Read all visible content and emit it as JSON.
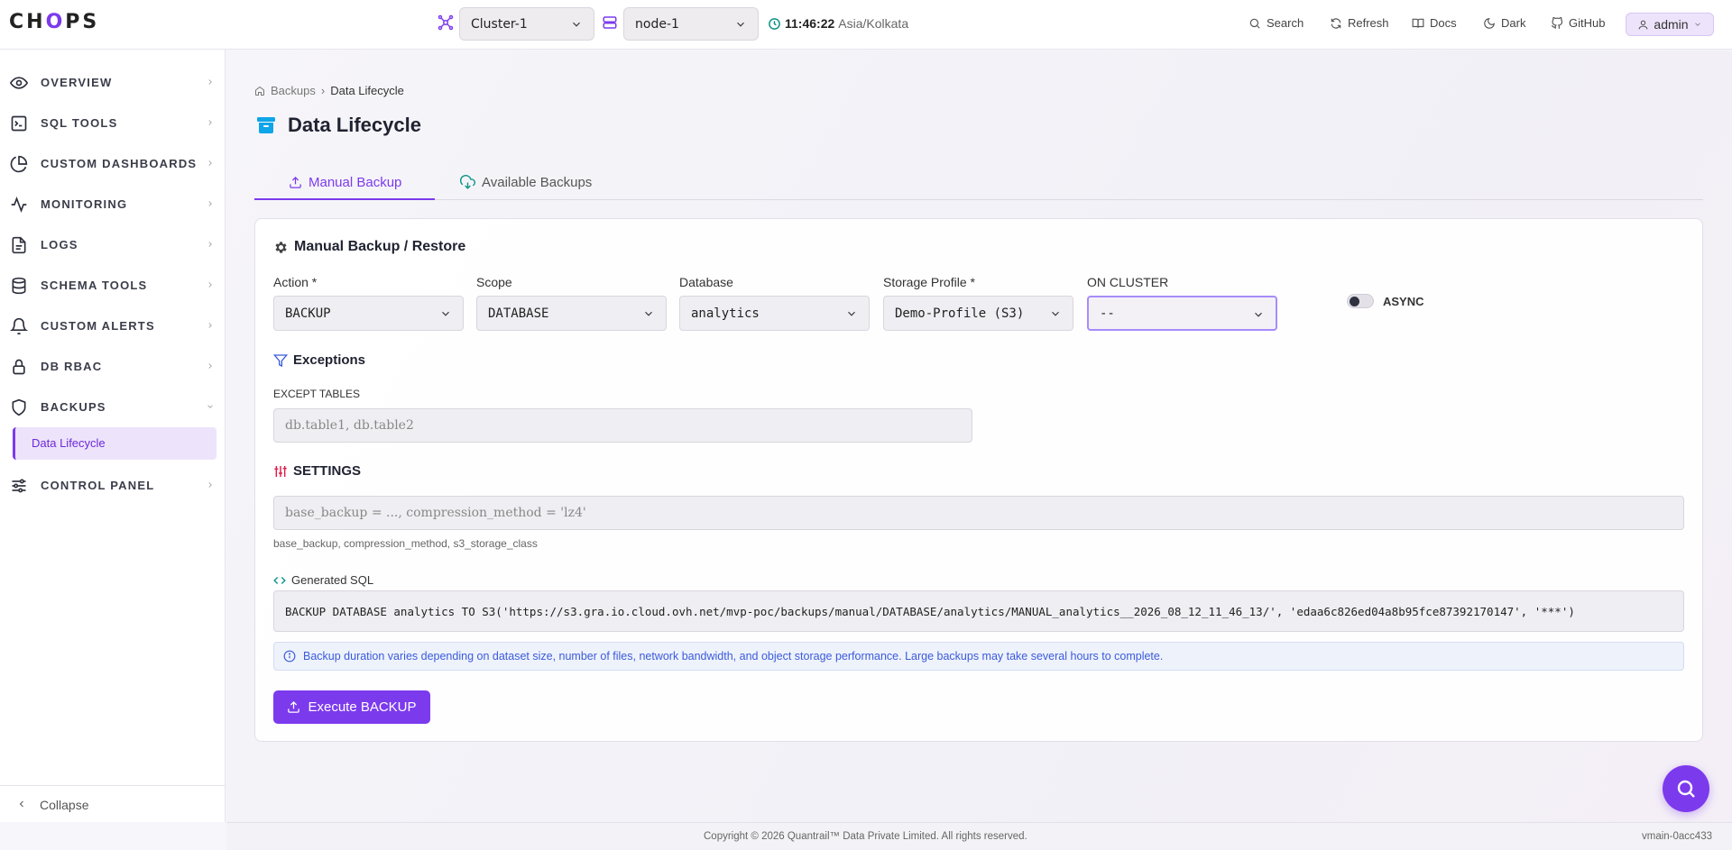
{
  "header": {
    "logo_pre": "CH",
    "logo_o": "O",
    "logo_post": "PS",
    "cluster_select": "Cluster-1",
    "node_select": "node-1",
    "time": "11:46:22",
    "timezone": "Asia/Kolkata",
    "links": {
      "search": "Search",
      "refresh": "Refresh",
      "docs": "Docs",
      "dark": "Dark",
      "github": "GitHub"
    },
    "user": "admin"
  },
  "sidebar": {
    "items": [
      {
        "label": "OVERVIEW",
        "icon": "eye-icon"
      },
      {
        "label": "SQL TOOLS",
        "icon": "terminal-icon"
      },
      {
        "label": "CUSTOM DASHBOARDS",
        "icon": "pie-chart-icon"
      },
      {
        "label": "MONITORING",
        "icon": "activity-icon"
      },
      {
        "label": "LOGS",
        "icon": "file-icon"
      },
      {
        "label": "SCHEMA TOOLS",
        "icon": "database-icon"
      },
      {
        "label": "CUSTOM ALERTS",
        "icon": "bell-icon"
      },
      {
        "label": "DB RBAC",
        "icon": "lock-icon"
      },
      {
        "label": "BACKUPS",
        "icon": "shield-icon"
      },
      {
        "label": "CONTROL PANEL",
        "icon": "sliders-icon"
      }
    ],
    "active_sub": "Data Lifecycle",
    "collapse_label": "Collapse"
  },
  "page": {
    "breadcrumb_root": "Backups",
    "breadcrumb_current": "Data Lifecycle",
    "title": "Data Lifecycle",
    "tabs": {
      "manual": "Manual Backup",
      "available": "Available Backups"
    }
  },
  "form": {
    "card_title": "Manual Backup / Restore",
    "fields": {
      "action": {
        "label": "Action *",
        "value": "BACKUP"
      },
      "scope": {
        "label": "Scope",
        "value": "DATABASE"
      },
      "database": {
        "label": "Database",
        "value": "analytics"
      },
      "storage": {
        "label": "Storage Profile *",
        "value": "Demo-Profile (S3)"
      },
      "cluster": {
        "label": "ON CLUSTER",
        "value": "--"
      }
    },
    "async_label": "ASYNC",
    "async_on": false,
    "exceptions_title": "Exceptions",
    "except_tables_label": "EXCEPT TABLES",
    "except_tables_placeholder": "db.table1, db.table2",
    "settings_title": "SETTINGS",
    "settings_placeholder": "base_backup = ..., compression_method = 'lz4'",
    "settings_hint": "base_backup, compression_method, s3_storage_class",
    "generated_sql_label": "Generated SQL",
    "generated_sql": "BACKUP DATABASE analytics TO S3('https://s3.gra.io.cloud.ovh.net/mvp-poc/backups/manual/DATABASE/analytics/MANUAL_analytics__2026_08_12_11_46_13/', 'edaa6c826ed04a8b95fce87392170147', '***')",
    "info_text": "Backup duration varies depending on dataset size, number of files, network bandwidth, and object storage performance. Large backups may take several hours to complete.",
    "execute_label": "Execute BACKUP"
  },
  "footer": {
    "copyright": "Copyright © 2026 Quantrail™ Data Private Limited. All rights reserved.",
    "version": "vmain-0acc433"
  },
  "colors": {
    "accent": "#7c3aed",
    "info": "#3b5bdb",
    "settings_icon": "#e11d48",
    "clock_icon": "#0d9488",
    "cluster_icon": "#7c3aed",
    "page_icon": "#0ea5e9"
  }
}
